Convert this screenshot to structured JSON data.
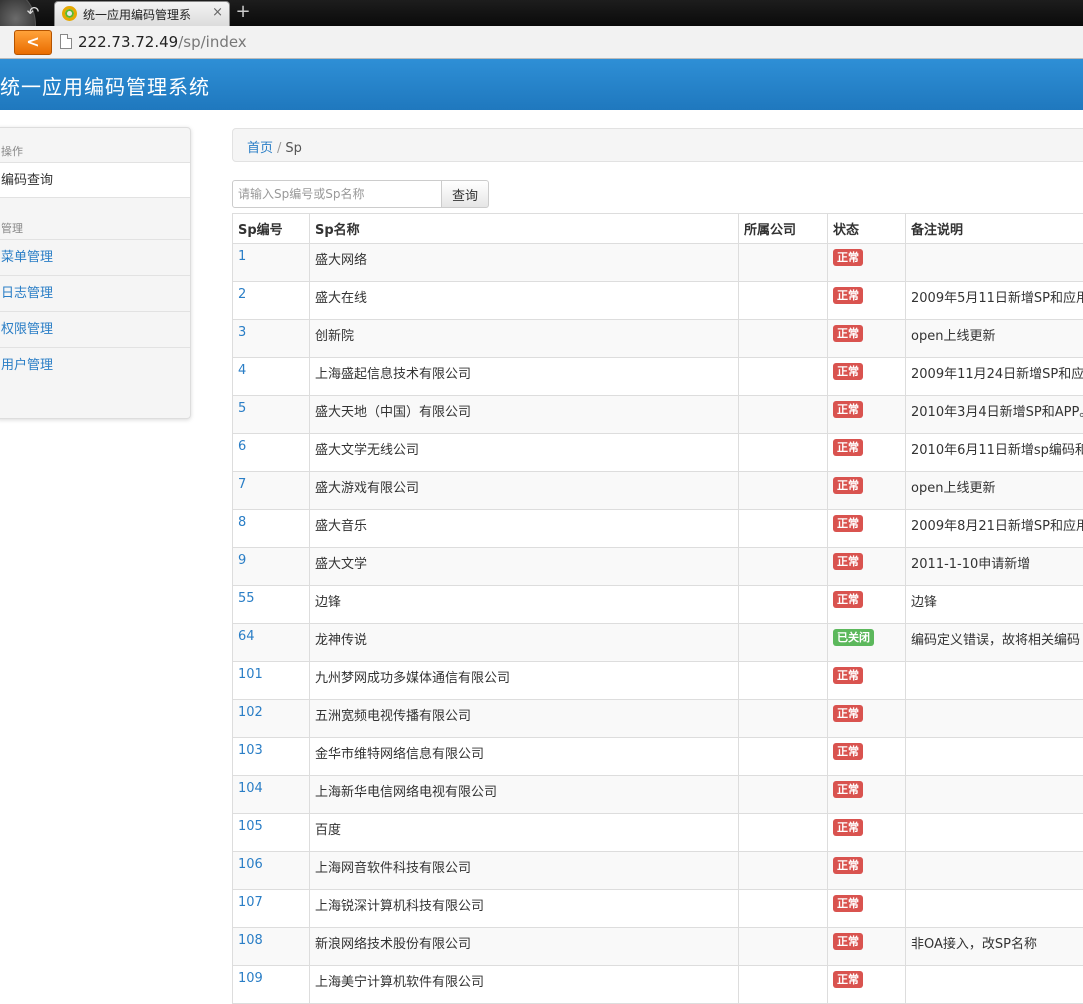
{
  "browser": {
    "tab_title": "统一应用编码管理系",
    "tab_close": "×",
    "new_tab": "+",
    "back": "<",
    "url_host": "222.73.72.49",
    "url_path": "/sp/index"
  },
  "app": {
    "title": "统一应用编码管理系统"
  },
  "sidebar": {
    "section1": "操作",
    "active_item": "编码查询",
    "section2": "管理",
    "items": [
      "菜单管理",
      "日志管理",
      "权限管理",
      "用户管理"
    ]
  },
  "breadcrumb": {
    "home": "首页",
    "sep": "/",
    "current": "Sp"
  },
  "search": {
    "placeholder": "请输入Sp编号或Sp名称",
    "button": "查询"
  },
  "table": {
    "headers": [
      "Sp编号",
      "Sp名称",
      "所属公司",
      "状态",
      "备注说明"
    ],
    "rows": [
      {
        "id": "1",
        "name": "盛大网络",
        "company": "",
        "status": "正常",
        "status_type": "danger",
        "note": ""
      },
      {
        "id": "2",
        "name": "盛大在线",
        "company": "",
        "status": "正常",
        "status_type": "danger",
        "note": "2009年5月11日新增SP和应用"
      },
      {
        "id": "3",
        "name": "创新院",
        "company": "",
        "status": "正常",
        "status_type": "danger",
        "note": "open上线更新"
      },
      {
        "id": "4",
        "name": "上海盛起信息技术有限公司",
        "company": "",
        "status": "正常",
        "status_type": "danger",
        "note": "2009年11月24日新增SP和应"
      },
      {
        "id": "5",
        "name": "盛大天地（中国）有限公司",
        "company": "",
        "status": "正常",
        "status_type": "danger",
        "note": "2010年3月4日新增SP和APP。"
      },
      {
        "id": "6",
        "name": "盛大文学无线公司",
        "company": "",
        "status": "正常",
        "status_type": "danger",
        "note": "2010年6月11日新增sp编码和"
      },
      {
        "id": "7",
        "name": "盛大游戏有限公司",
        "company": "",
        "status": "正常",
        "status_type": "danger",
        "note": "open上线更新"
      },
      {
        "id": "8",
        "name": "盛大音乐",
        "company": "",
        "status": "正常",
        "status_type": "danger",
        "note": "2009年8月21日新增SP和应用"
      },
      {
        "id": "9",
        "name": "盛大文学",
        "company": "",
        "status": "正常",
        "status_type": "danger",
        "note": "2011-1-10申请新增"
      },
      {
        "id": "55",
        "name": "边锋",
        "company": "",
        "status": "正常",
        "status_type": "danger",
        "note": "边锋"
      },
      {
        "id": "64",
        "name": "龙神传说",
        "company": "",
        "status": "已关闭",
        "status_type": "success",
        "note": "编码定义错误，故将相关编码"
      },
      {
        "id": "101",
        "name": "九州梦网成功多媒体通信有限公司",
        "company": "",
        "status": "正常",
        "status_type": "danger",
        "note": ""
      },
      {
        "id": "102",
        "name": "五洲宽频电视传播有限公司",
        "company": "",
        "status": "正常",
        "status_type": "danger",
        "note": ""
      },
      {
        "id": "103",
        "name": "金华市维特网络信息有限公司",
        "company": "",
        "status": "正常",
        "status_type": "danger",
        "note": ""
      },
      {
        "id": "104",
        "name": "上海新华电信网络电视有限公司",
        "company": "",
        "status": "正常",
        "status_type": "danger",
        "note": ""
      },
      {
        "id": "105",
        "name": "百度",
        "company": "",
        "status": "正常",
        "status_type": "danger",
        "note": ""
      },
      {
        "id": "106",
        "name": "上海网音软件科技有限公司",
        "company": "",
        "status": "正常",
        "status_type": "danger",
        "note": ""
      },
      {
        "id": "107",
        "name": "上海锐深计算机科技有限公司",
        "company": "",
        "status": "正常",
        "status_type": "danger",
        "note": ""
      },
      {
        "id": "108",
        "name": "新浪网络技术股份有限公司",
        "company": "",
        "status": "正常",
        "status_type": "danger",
        "note": "非OA接入，改SP名称"
      },
      {
        "id": "109",
        "name": "上海美宁计算机软件有限公司",
        "company": "",
        "status": "正常",
        "status_type": "danger",
        "note": ""
      }
    ]
  },
  "colors": {
    "header_blue": "#2583cb",
    "link_blue": "#2a7ec6",
    "danger": "#d9534f",
    "success": "#5cb85c"
  }
}
